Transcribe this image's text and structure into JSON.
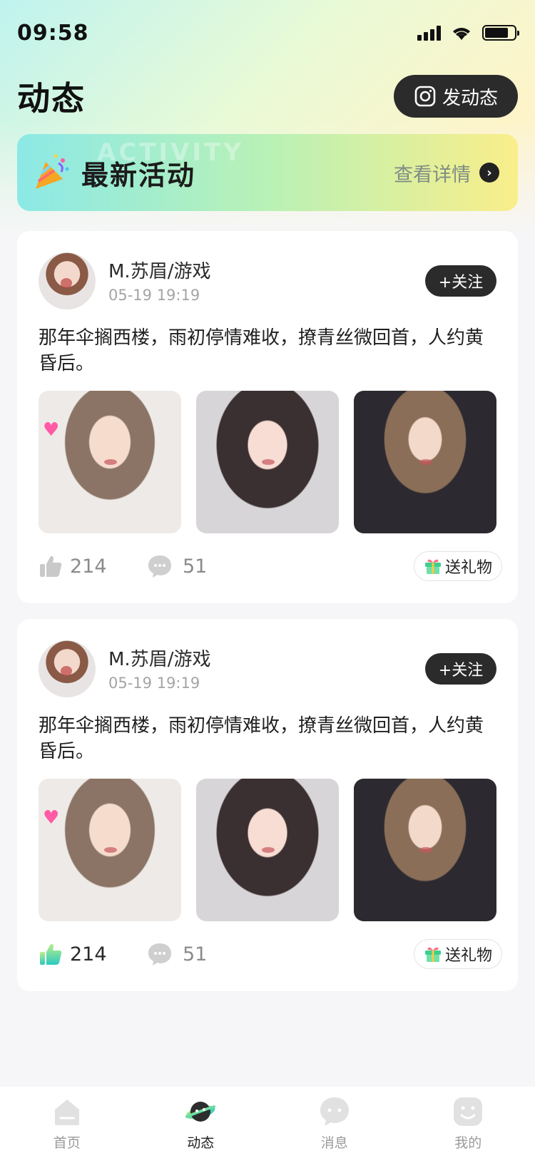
{
  "status_bar": {
    "time": "09:58",
    "battery_level_fraction": 0.8
  },
  "header": {
    "title": "动态",
    "post_button_label": "发动态"
  },
  "banner": {
    "ghost_text": "ACTIVITY",
    "title": "最新活动",
    "link_label": "查看详情"
  },
  "posts": [
    {
      "user_name": "M.苏眉/游戏",
      "time": "05-19 19:19",
      "follow_label": "+关注",
      "text": "那年伞搁西楼，雨初停情难收，撩青丝微回首，人约黄昏后。",
      "likes": "214",
      "liked": false,
      "comments": "51",
      "gift_label": "送礼物"
    },
    {
      "user_name": "M.苏眉/游戏",
      "time": "05-19 19:19",
      "follow_label": "+关注",
      "text": "那年伞搁西楼，雨初停情难收，撩青丝微回首，人约黄昏后。",
      "likes": "214",
      "liked": true,
      "comments": "51",
      "gift_label": "送礼物"
    }
  ],
  "tabbar": {
    "tabs": [
      {
        "label": "首页",
        "icon": "home-icon",
        "active": false
      },
      {
        "label": "动态",
        "icon": "planet-icon",
        "active": true
      },
      {
        "label": "消息",
        "icon": "chat-bubble-icon",
        "active": false
      },
      {
        "label": "我的",
        "icon": "smiley-icon",
        "active": false
      }
    ]
  },
  "colors": {
    "accent_dark": "#2b2b2b",
    "like_active": "#34d3a8",
    "banner_start": "#8ce9e6",
    "banner_end": "#f9ee8a"
  }
}
